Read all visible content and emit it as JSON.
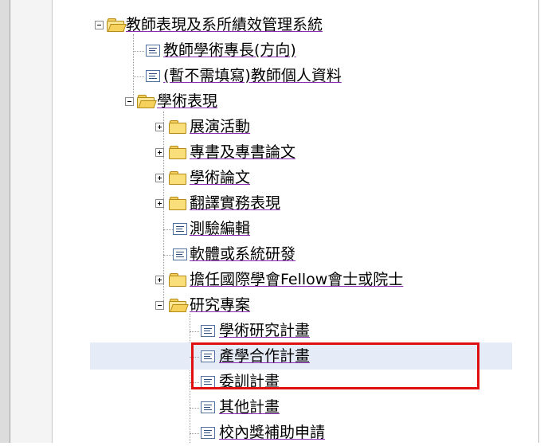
{
  "tree": {
    "root": "教師表現及系所績效管理系統",
    "items": [
      {
        "label": "教師學術專長(方向)"
      },
      {
        "label": "(暫不需填寫)教師個人資料"
      },
      {
        "label": "學術表現"
      },
      {
        "label": "展演活動"
      },
      {
        "label": "專書及專書論文"
      },
      {
        "label": "學術論文"
      },
      {
        "label": "翻譯實務表現"
      },
      {
        "label": "測驗編輯"
      },
      {
        "label": "軟體或系統研發"
      },
      {
        "label": "擔任國際學會Fellow會士或院士"
      },
      {
        "label": "研究專案"
      },
      {
        "label": "學術研究計畫"
      },
      {
        "label": "產學合作計畫"
      },
      {
        "label": "委訓計畫"
      },
      {
        "label": "其他計畫"
      },
      {
        "label": "校內獎補助申請"
      }
    ]
  },
  "colors": {
    "highlight": "#e6ecf7",
    "annotation": "#e01010",
    "underline": "#8b2bb4"
  }
}
